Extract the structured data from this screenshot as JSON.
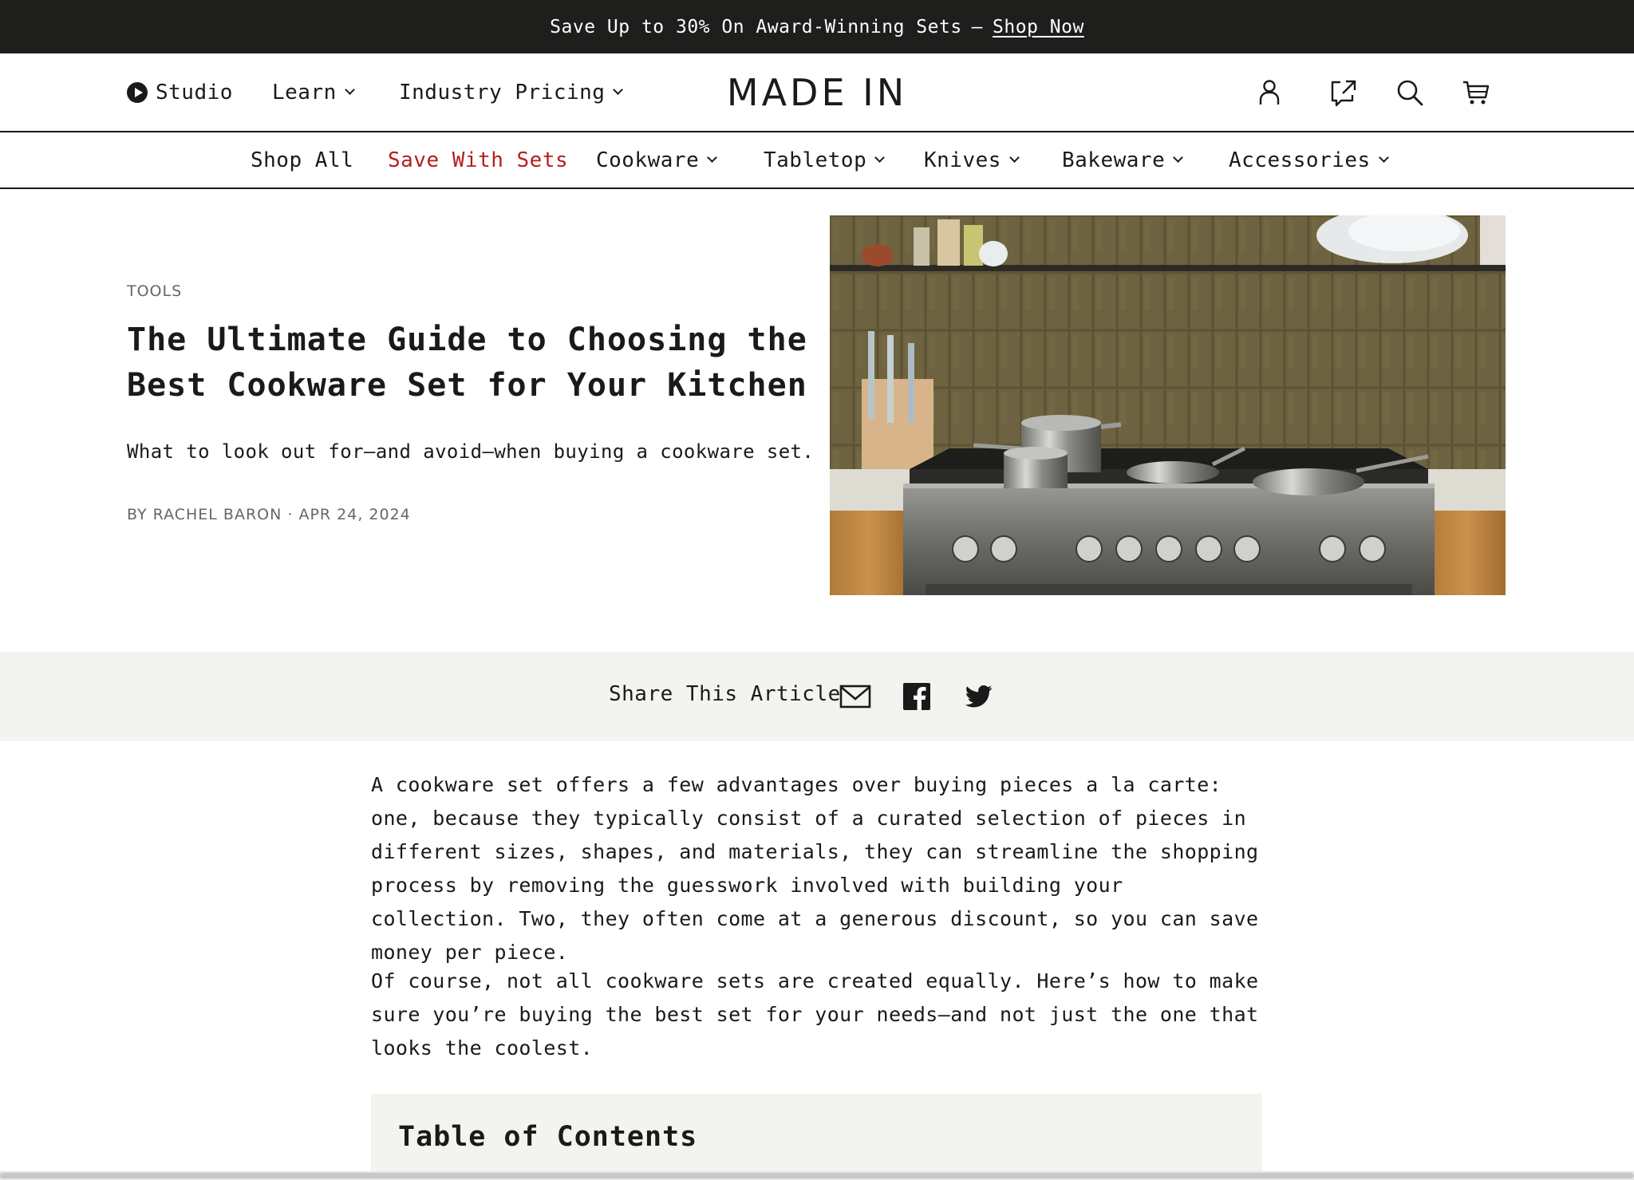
{
  "promo": {
    "text": "Save Up to 30% On Award-Winning Sets",
    "separator": "—",
    "link": "Shop Now"
  },
  "header": {
    "nav": [
      {
        "label": "Studio",
        "icon": "play-icon"
      },
      {
        "label": "Learn",
        "icon": "chevron-down-icon"
      },
      {
        "label": "Industry Pricing",
        "icon": "chevron-down-icon"
      }
    ],
    "logo": "MADE IN",
    "icons": [
      "user-icon",
      "share-external-icon",
      "search-icon",
      "cart-icon"
    ]
  },
  "catnav": {
    "items": [
      {
        "label": "Shop All"
      },
      {
        "label": "Save With Sets",
        "color": "#b41e1e"
      },
      {
        "label": "Cookware"
      },
      {
        "label": "Tabletop"
      },
      {
        "label": "Knives"
      },
      {
        "label": "Bakeware"
      },
      {
        "label": "Accessories"
      }
    ]
  },
  "article": {
    "category": "TOOLS",
    "title": "The Ultimate Guide to Choosing the Best Cookware Set for Your Kitchen",
    "subtitle": "What to look out for—and avoid—when buying a cookware set.",
    "byline": "BY RACHEL BARON · APR 24, 2024",
    "share_label": "Share This Article",
    "share_icons": [
      "email-icon",
      "facebook-icon",
      "twitter-icon"
    ],
    "paragraphs": [
      "A cookware set offers a few advantages over buying pieces a la carte: one, because they typically consist of a curated selection of pieces in different sizes, shapes, and materials, they can streamline the shopping process by removing the guesswork involved with building your collection. Two, they often come at a generous discount, so you can save money per piece.",
      "Of course, not all cookware sets are created equally. Here’s how to make sure you’re buying the best set for your needs—and not just the one that looks the coolest."
    ],
    "toc_title": "Table of Contents"
  },
  "colors": {
    "promo_bg": "#1e1f1c",
    "accent_red": "#b41e1e",
    "panel_bg": "#f3f3f0"
  }
}
